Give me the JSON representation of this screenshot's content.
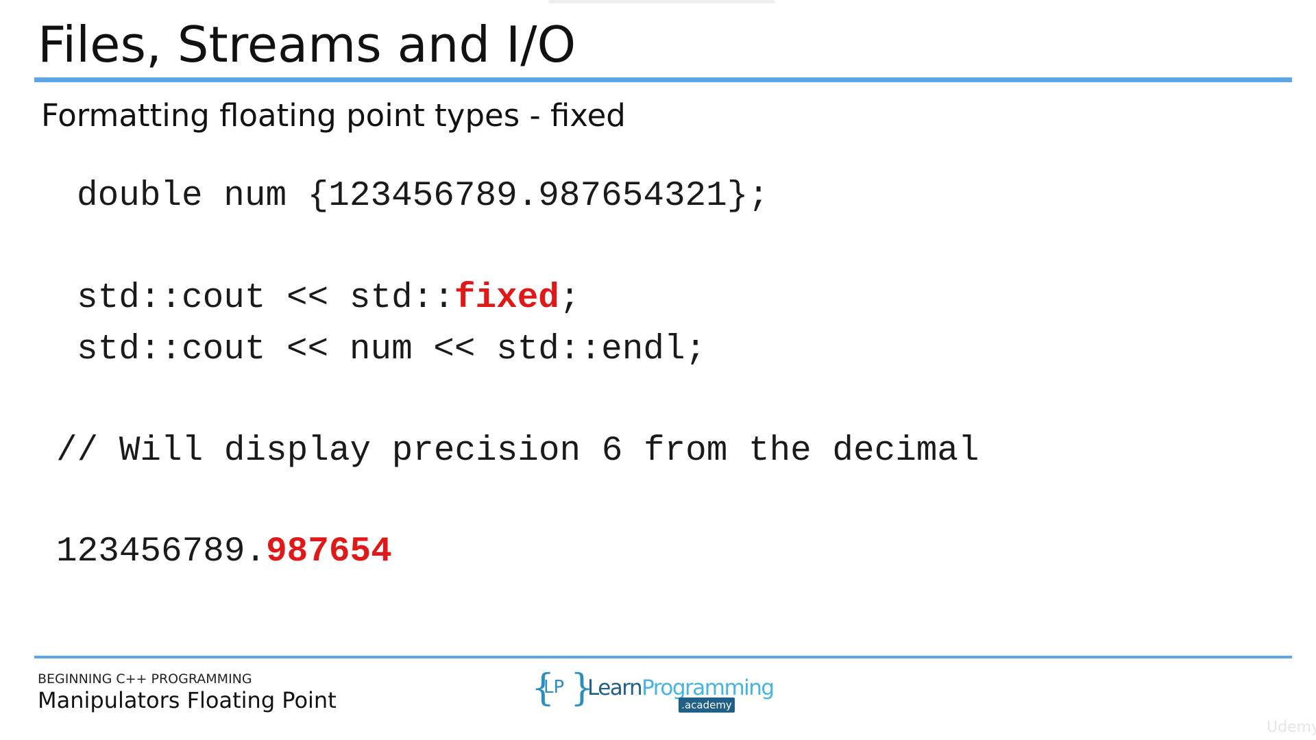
{
  "slide": {
    "title": "Files, Streams and I/O",
    "subtitle": "Formatting floating point types  - fixed"
  },
  "code": {
    "line1": "double num {123456789.987654321};",
    "line2_prefix": "std::cout << std::",
    "line2_keyword": "fixed",
    "line2_suffix": ";",
    "line3": "std::cout << num << std::endl;",
    "comment": "// Will display precision 6 from the decimal",
    "output_int": "123456789.",
    "output_frac": "987654"
  },
  "footer": {
    "course": "BEGINNING C++ PROGRAMMING",
    "lesson": "Manipulators Floating Point",
    "logo": {
      "brace_left": "{",
      "initials": "LP",
      "brace_right": "}",
      "word_learn": "Learn",
      "word_programming": "Programming",
      "sub": ".academy"
    },
    "watermark": "Udemy"
  },
  "colors": {
    "accent_rule": "#5aa6e8",
    "highlight_red": "#e01818",
    "logo_dark": "#1f5f88",
    "logo_light": "#45b3e6"
  }
}
